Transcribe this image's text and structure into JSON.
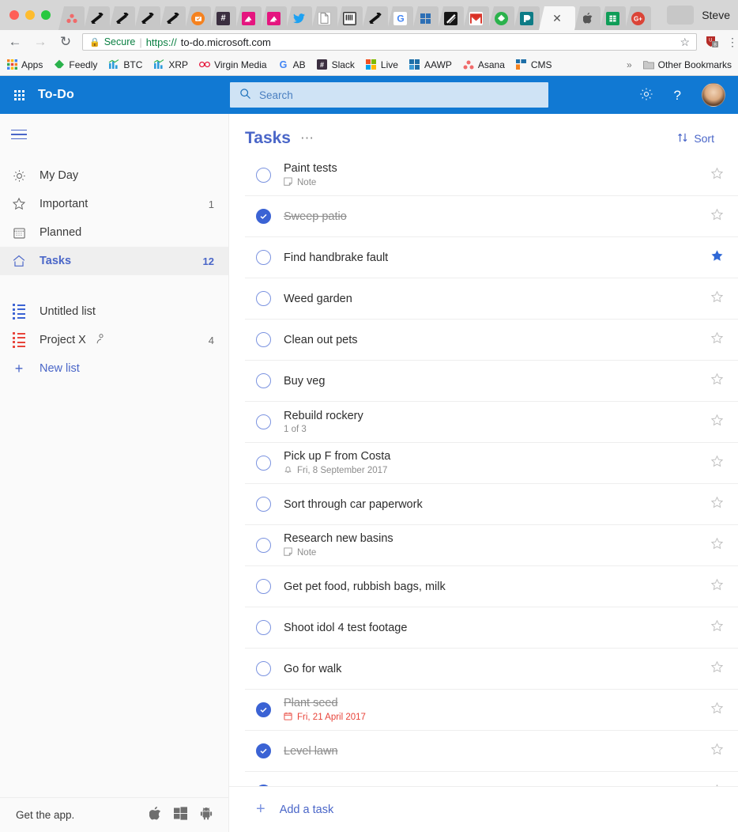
{
  "browser": {
    "profile_name": "Steve",
    "tabs": [
      {
        "icon": "asana-icon",
        "glyph": "⋰",
        "kind": "asana",
        "active": false
      },
      {
        "icon": "telescope-icon",
        "glyph": "➤",
        "kind": "telescope",
        "active": false
      },
      {
        "icon": "telescope-icon",
        "glyph": "➤",
        "kind": "telescope",
        "active": false
      },
      {
        "icon": "telescope-icon",
        "glyph": "➤",
        "kind": "telescope",
        "active": false
      },
      {
        "icon": "telescope-icon",
        "glyph": "➤",
        "kind": "telescope",
        "active": false
      },
      {
        "icon": "calendar-icon",
        "glyph": "▣",
        "kind": "orange",
        "active": false
      },
      {
        "icon": "slack-icon",
        "glyph": "#",
        "kind": "hash",
        "active": false
      },
      {
        "icon": "image-icon",
        "glyph": "◢",
        "kind": "pink",
        "active": false
      },
      {
        "icon": "image-icon",
        "glyph": "◢",
        "kind": "pink",
        "active": false
      },
      {
        "icon": "twitter-icon",
        "glyph": "✈",
        "kind": "twitter",
        "active": false
      },
      {
        "icon": "document-icon",
        "glyph": "▯",
        "kind": "doc",
        "active": false
      },
      {
        "icon": "piano-icon",
        "glyph": "‖",
        "kind": "piano",
        "active": false
      },
      {
        "icon": "telescope-icon",
        "glyph": "➤",
        "kind": "telescope",
        "active": false
      },
      {
        "icon": "google-icon",
        "glyph": "G",
        "kind": "google",
        "active": false
      },
      {
        "icon": "microsoft-icon",
        "glyph": "",
        "kind": "msblue",
        "active": false
      },
      {
        "icon": "dark-squiggle-icon",
        "glyph": "╱",
        "kind": "dark",
        "active": false
      },
      {
        "icon": "gmail-icon",
        "glyph": "M",
        "kind": "gmail",
        "active": false
      },
      {
        "icon": "feedly-icon",
        "glyph": "◆",
        "kind": "feedly",
        "active": false
      },
      {
        "icon": "teal-app-icon",
        "glyph": "◗",
        "kind": "teal",
        "active": false
      },
      {
        "icon": "close-icon",
        "glyph": "✕",
        "kind": "close",
        "active": true
      },
      {
        "icon": "apple-icon",
        "glyph": "●",
        "kind": "apple",
        "active": false
      },
      {
        "icon": "sheets-icon",
        "glyph": "▦",
        "kind": "sheets",
        "active": false
      },
      {
        "icon": "google-plus-icon",
        "glyph": "G+",
        "kind": "gplus",
        "active": false
      }
    ],
    "omnibox": {
      "secure_label": "Secure",
      "scheme": "https://",
      "host": "to-do.microsoft.com",
      "extension_badge": "8"
    },
    "bookmarks": [
      {
        "label": "Apps",
        "icon": "apps-grid-icon",
        "color": "#f5821f"
      },
      {
        "label": "Feedly",
        "icon": "feedly-icon",
        "color": "#2bb24c"
      },
      {
        "label": "BTC",
        "icon": "chart-icon",
        "color": "#2d9cdb"
      },
      {
        "label": "XRP",
        "icon": "chart-icon",
        "color": "#2d9cdb"
      },
      {
        "label": "Virgin Media",
        "icon": "virgin-media-icon",
        "color": "#e4002b"
      },
      {
        "label": "AB",
        "icon": "google-icon",
        "color": "#4285f4"
      },
      {
        "label": "Slack",
        "icon": "slack-icon",
        "color": "#3b2f40"
      },
      {
        "label": "Live",
        "icon": "microsoft-icon",
        "color": "#f25022"
      },
      {
        "label": "AAWP",
        "icon": "squares-icon",
        "color": "#1e6fa8"
      },
      {
        "label": "Asana",
        "icon": "asana-icon",
        "color": "#f06a6a"
      },
      {
        "label": "CMS",
        "icon": "cms-icon",
        "color": "#f5821f"
      }
    ],
    "overflow_label": "»",
    "other_bookmarks_label": "Other Bookmarks"
  },
  "appbar": {
    "waffle": "app-launcher-icon",
    "brand": "To-Do",
    "search_placeholder": "Search",
    "search_value": "",
    "settings_icon": "gear-icon",
    "help_icon": "help-icon",
    "avatar": "user-avatar"
  },
  "sidebar": {
    "menu_icon": "hamburger-icon",
    "smart_lists": [
      {
        "label": "My Day",
        "icon": "sun-icon",
        "count": "",
        "active": false
      },
      {
        "label": "Important",
        "icon": "star-icon",
        "count": "1",
        "active": false
      },
      {
        "label": "Planned",
        "icon": "calendar-icon",
        "count": "",
        "active": false
      },
      {
        "label": "Tasks",
        "icon": "home-icon",
        "count": "12",
        "active": true
      }
    ],
    "custom_lists": [
      {
        "label": "Untitled list",
        "icon": "list-icon",
        "color": "#3b63d4",
        "count": "",
        "shared": false
      },
      {
        "label": "Project X",
        "icon": "list-icon",
        "color": "#e8443a",
        "count": "4",
        "shared": true
      }
    ],
    "new_list_label": "New list",
    "footer": {
      "label": "Get the app.",
      "icons": [
        "apple-icon",
        "windows-icon",
        "android-icon"
      ]
    }
  },
  "main": {
    "title": "Tasks",
    "more_icon": "ellipsis-icon",
    "sort_label": "Sort",
    "sort_icon": "sort-icon",
    "add_task_label": "Add a task",
    "add_task_icon": "plus-icon",
    "tasks": [
      {
        "title": "Paint tests",
        "completed": false,
        "starred": false,
        "meta": "Note",
        "meta_icon": "note-icon",
        "overdue": false
      },
      {
        "title": "Sweep patio",
        "completed": true,
        "starred": false,
        "meta": "",
        "meta_icon": "",
        "overdue": false
      },
      {
        "title": "Find handbrake fault",
        "completed": false,
        "starred": true,
        "meta": "",
        "meta_icon": "",
        "overdue": false
      },
      {
        "title": "Weed garden",
        "completed": false,
        "starred": false,
        "meta": "",
        "meta_icon": "",
        "overdue": false
      },
      {
        "title": "Clean out pets",
        "completed": false,
        "starred": false,
        "meta": "",
        "meta_icon": "",
        "overdue": false
      },
      {
        "title": "Buy veg",
        "completed": false,
        "starred": false,
        "meta": "",
        "meta_icon": "",
        "overdue": false
      },
      {
        "title": "Rebuild rockery",
        "completed": false,
        "starred": false,
        "meta": "1 of 3",
        "meta_icon": "",
        "overdue": false
      },
      {
        "title": "Pick up F from Costa",
        "completed": false,
        "starred": false,
        "meta": "Fri, 8 September 2017",
        "meta_icon": "bell-icon",
        "overdue": false
      },
      {
        "title": "Sort through car paperwork",
        "completed": false,
        "starred": false,
        "meta": "",
        "meta_icon": "",
        "overdue": false
      },
      {
        "title": "Research new basins",
        "completed": false,
        "starred": false,
        "meta": "Note",
        "meta_icon": "note-icon",
        "overdue": false
      },
      {
        "title": "Get pet food, rubbish bags, milk",
        "completed": false,
        "starred": false,
        "meta": "",
        "meta_icon": "",
        "overdue": false
      },
      {
        "title": "Shoot idol 4 test footage",
        "completed": false,
        "starred": false,
        "meta": "",
        "meta_icon": "",
        "overdue": false
      },
      {
        "title": "Go for walk",
        "completed": false,
        "starred": false,
        "meta": "",
        "meta_icon": "",
        "overdue": false
      },
      {
        "title": "Plant seed",
        "completed": true,
        "starred": false,
        "meta": "Fri, 21 April 2017",
        "meta_icon": "calendar-icon",
        "overdue": true
      },
      {
        "title": "Level lawn",
        "completed": true,
        "starred": false,
        "meta": "",
        "meta_icon": "",
        "overdue": false
      },
      {
        "title": "",
        "completed": true,
        "starred": false,
        "meta": "",
        "meta_icon": "",
        "overdue": false
      }
    ]
  },
  "colors": {
    "accent_blue": "#4a66c8",
    "appbar_blue": "#1179d3",
    "check_blue": "#3b63d4",
    "star_on": "#2f68d6",
    "overdue_red": "#e8443a"
  }
}
